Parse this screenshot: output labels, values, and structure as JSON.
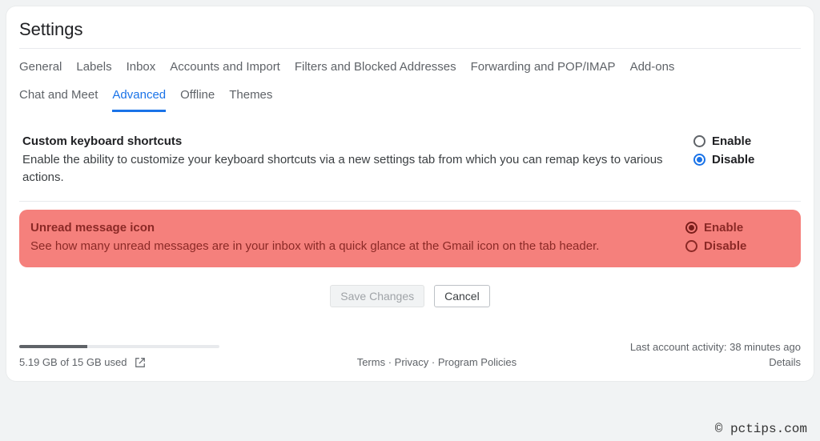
{
  "title": "Settings",
  "tabs": {
    "row1": [
      "General",
      "Labels",
      "Inbox",
      "Accounts and Import",
      "Filters and Blocked Addresses",
      "Forwarding and POP/IMAP",
      "Add-ons"
    ],
    "row2": [
      "Chat and Meet",
      "Advanced",
      "Offline",
      "Themes"
    ]
  },
  "active_tab": "Advanced",
  "sections": {
    "custom_shortcuts": {
      "title": "Custom keyboard shortcuts",
      "desc": "Enable the ability to customize your keyboard shortcuts via a new settings tab from which you can remap keys to various actions.",
      "enable": "Enable",
      "disable": "Disable",
      "selected": "Disable"
    },
    "unread_icon": {
      "title": "Unread message icon",
      "desc": "See how many unread messages are in your inbox with a quick glance at the Gmail icon on the tab header.",
      "enable": "Enable",
      "disable": "Disable",
      "selected": "Enable"
    }
  },
  "buttons": {
    "save": "Save Changes",
    "cancel": "Cancel"
  },
  "footer": {
    "storage_text": "5.19 GB of 15 GB used",
    "storage_pct": 34,
    "terms": "Terms",
    "privacy": "Privacy",
    "policies": "Program Policies",
    "sep": " · ",
    "activity": "Last account activity: 38 minutes ago",
    "details": "Details"
  },
  "watermark": "© pctips.com"
}
